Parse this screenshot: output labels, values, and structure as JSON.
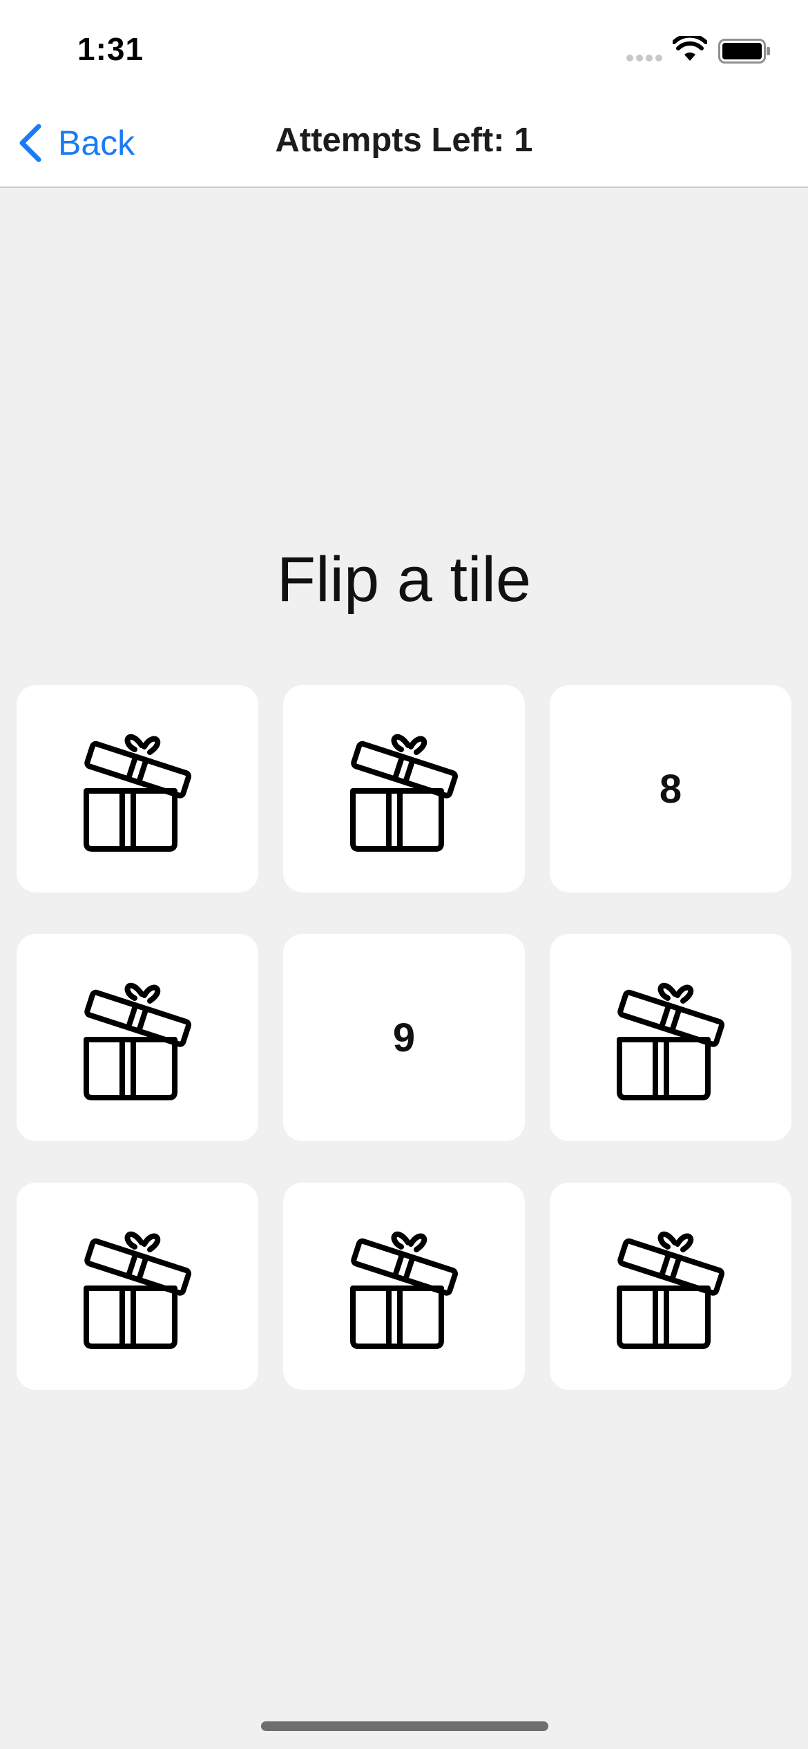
{
  "status_bar": {
    "time": "1:31"
  },
  "nav": {
    "back_label": "Back",
    "title": "Attempts Left: 1"
  },
  "prompt": "Flip a tile",
  "tiles": [
    {
      "state": "hidden",
      "icon": "gift-icon",
      "label": ""
    },
    {
      "state": "hidden",
      "icon": "gift-icon",
      "label": ""
    },
    {
      "state": "revealed",
      "icon": "",
      "label": "8"
    },
    {
      "state": "hidden",
      "icon": "gift-icon",
      "label": ""
    },
    {
      "state": "revealed",
      "icon": "",
      "label": "9"
    },
    {
      "state": "hidden",
      "icon": "gift-icon",
      "label": ""
    },
    {
      "state": "hidden",
      "icon": "gift-icon",
      "label": ""
    },
    {
      "state": "hidden",
      "icon": "gift-icon",
      "label": ""
    },
    {
      "state": "hidden",
      "icon": "gift-icon",
      "label": ""
    }
  ],
  "colors": {
    "accent": "#1a7cf5",
    "background": "#f0f0f0",
    "tile": "#ffffff",
    "icon": "#000000"
  }
}
